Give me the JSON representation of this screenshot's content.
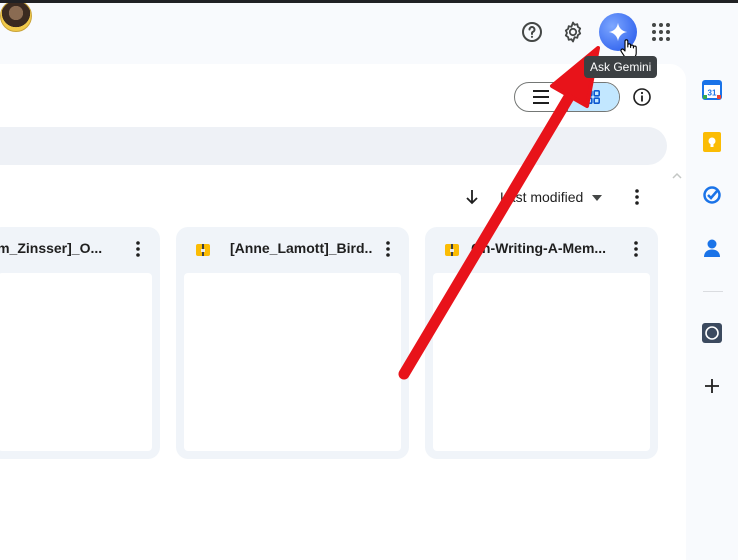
{
  "header": {
    "icons": {
      "help": "help-circle-icon",
      "settings": "gear-icon",
      "gemini": "gemini-sparkle-icon",
      "apps": "apps-grid-icon",
      "avatar": "user-avatar"
    },
    "tooltip": "Ask Gemini"
  },
  "toolbar": {
    "view_modes": [
      "list",
      "grid"
    ],
    "active_view": "grid",
    "sort_label": "Last modified"
  },
  "files": [
    {
      "title": "[William_Zinsser]_O...",
      "type": "archive"
    },
    {
      "title": "[Anne_Lamott]_Bird...",
      "type": "archive"
    },
    {
      "title": "On-Writing-A-Mem...",
      "type": "archive"
    }
  ],
  "side_panel": {
    "apps": [
      "Calendar",
      "Keep",
      "Tasks",
      "Contacts"
    ],
    "calendar_day": "31",
    "colors": {
      "calendar": "#1a73e8",
      "keep": "#fbbc04",
      "tasks": "#1a73e8",
      "contacts": "#1a73e8"
    }
  },
  "colors": {
    "accent": "#c2e7ff",
    "annotation_arrow": "#e8131a"
  }
}
